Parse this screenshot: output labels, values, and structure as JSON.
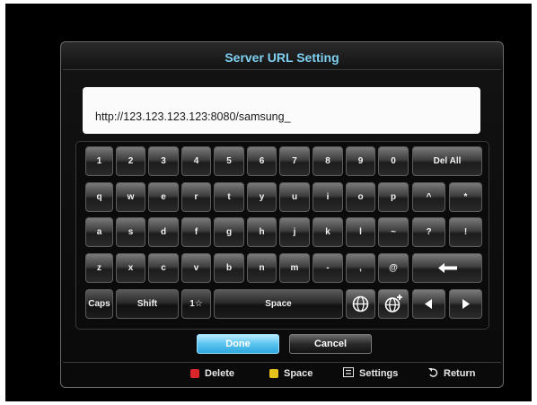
{
  "dialog": {
    "title": "Server URL Setting",
    "url_value": "http://123.123.123.123:8080/samsung_"
  },
  "keyboard": {
    "row1": [
      "1",
      "2",
      "3",
      "4",
      "5",
      "6",
      "7",
      "8",
      "9",
      "0",
      "Del All"
    ],
    "row2": [
      "q",
      "w",
      "e",
      "r",
      "t",
      "y",
      "u",
      "i",
      "o",
      "p",
      "^",
      "*"
    ],
    "row3": [
      "a",
      "s",
      "d",
      "f",
      "g",
      "h",
      "j",
      "k",
      "l",
      "~",
      "?",
      "!"
    ],
    "row4": [
      "z",
      "x",
      "c",
      "v",
      "b",
      "n",
      "m",
      "-",
      ",",
      "@"
    ],
    "row5": {
      "caps": "Caps",
      "shift": "Shift",
      "symbols": "1☆",
      "space": "Space"
    }
  },
  "buttons": {
    "done": "Done",
    "cancel": "Cancel"
  },
  "footer": {
    "delete": "Delete",
    "space": "Space",
    "settings": "Settings",
    "return": "Return"
  },
  "colors": {
    "title": "#7fd0f2",
    "done_button": "#5cc4f0",
    "delete_key_icon": "#d9262b",
    "space_key_icon": "#e8c21a"
  },
  "icons": [
    "backspace-arrow-icon",
    "globe-icon",
    "globe-plus-icon",
    "arrow-left-icon",
    "arrow-right-icon",
    "settings-icon",
    "return-icon"
  ]
}
